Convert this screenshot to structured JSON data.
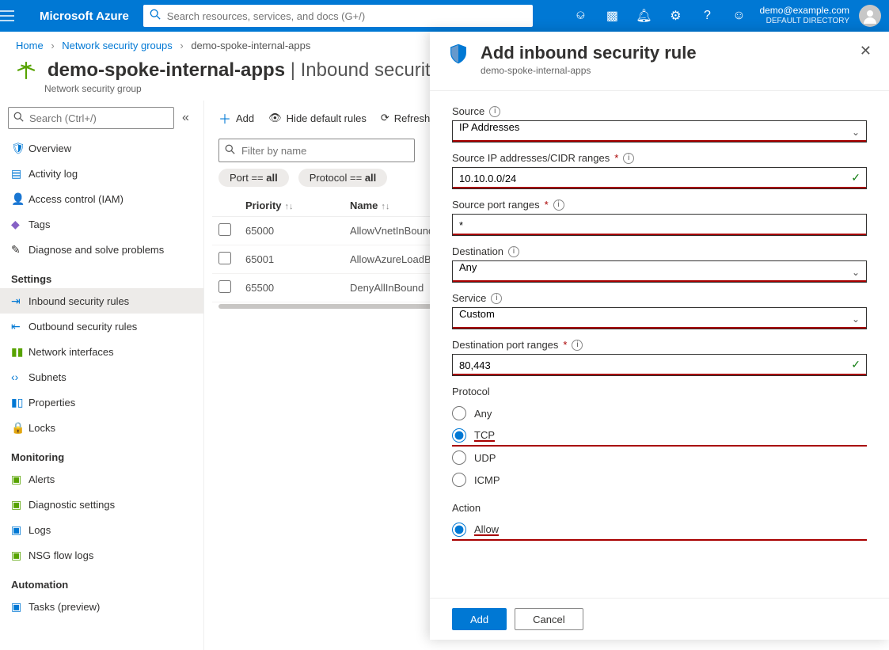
{
  "topbar": {
    "brand": "Microsoft Azure",
    "search_placeholder": "Search resources, services, and docs (G+/)",
    "account_email": "demo@example.com",
    "account_dir": "DEFAULT DIRECTORY"
  },
  "breadcrumbs": [
    {
      "label": "Home"
    },
    {
      "label": "Network security groups"
    },
    {
      "label": "demo-spoke-internal-apps"
    }
  ],
  "page": {
    "title": "demo-spoke-internal-apps",
    "title_suffix": " | Inbound security",
    "subtitle": "Network security group"
  },
  "side_search_placeholder": "Search (Ctrl+/)",
  "sidebar": [
    {
      "icon": "🛡",
      "iconColor": "#0078d4",
      "label": "Overview"
    },
    {
      "icon": "▤",
      "iconColor": "#0078d4",
      "label": "Activity log"
    },
    {
      "icon": "👤",
      "iconColor": "#323130",
      "label": "Access control (IAM)"
    },
    {
      "icon": "◆",
      "iconColor": "#8661c5",
      "label": "Tags"
    },
    {
      "icon": "✎",
      "iconColor": "#323130",
      "label": "Diagnose and solve problems"
    }
  ],
  "sidebar_settings_header": "Settings",
  "sidebar_settings": [
    {
      "icon": "⇥",
      "iconColor": "#0078d4",
      "label": "Inbound security rules",
      "active": true
    },
    {
      "icon": "⇤",
      "iconColor": "#0078d4",
      "label": "Outbound security rules"
    },
    {
      "icon": "▮▮",
      "iconColor": "#57a300",
      "label": "Network interfaces"
    },
    {
      "icon": "‹›",
      "iconColor": "#0078d4",
      "label": "Subnets"
    },
    {
      "icon": "▮▯",
      "iconColor": "#0078d4",
      "label": "Properties"
    },
    {
      "icon": "🔒",
      "iconColor": "#323130",
      "label": "Locks"
    }
  ],
  "sidebar_monitoring_header": "Monitoring",
  "sidebar_monitoring": [
    {
      "icon": "▣",
      "iconColor": "#57a300",
      "label": "Alerts"
    },
    {
      "icon": "▣",
      "iconColor": "#57a300",
      "label": "Diagnostic settings"
    },
    {
      "icon": "▣",
      "iconColor": "#0078d4",
      "label": "Logs"
    },
    {
      "icon": "▣",
      "iconColor": "#57a300",
      "label": "NSG flow logs"
    }
  ],
  "sidebar_automation_header": "Automation",
  "sidebar_automation": [
    {
      "icon": "▣",
      "iconColor": "#0078d4",
      "label": "Tasks (preview)"
    }
  ],
  "toolbar": {
    "add": "Add",
    "hide": "Hide default rules",
    "refresh": "Refresh"
  },
  "filter_placeholder": "Filter by name",
  "pills": {
    "port_label": "Port == ",
    "port_val": "all",
    "proto_label": "Protocol == ",
    "proto_val": "all"
  },
  "table": {
    "h_priority": "Priority",
    "h_name": "Name",
    "rows": [
      {
        "priority": "65000",
        "name": "AllowVnetInBound"
      },
      {
        "priority": "65001",
        "name": "AllowAzureLoadBalancerInBound"
      },
      {
        "priority": "65500",
        "name": "DenyAllInBound"
      }
    ]
  },
  "panel": {
    "title": "Add inbound security rule",
    "context": "demo-spoke-internal-apps",
    "labels": {
      "source": "Source",
      "source_ip": "Source IP addresses/CIDR ranges",
      "source_port": "Source port ranges",
      "destination": "Destination",
      "service": "Service",
      "dest_port": "Destination port ranges",
      "protocol": "Protocol",
      "action": "Action"
    },
    "values": {
      "source": "IP Addresses",
      "source_ip": "10.10.0.0/24",
      "source_port": "*",
      "destination": "Any",
      "service": "Custom",
      "dest_port": "80,443"
    },
    "protocol_options": [
      "Any",
      "TCP",
      "UDP",
      "ICMP"
    ],
    "protocol_selected": "TCP",
    "action_options": [
      "Allow"
    ],
    "action_selected": "Allow",
    "buttons": {
      "add": "Add",
      "cancel": "Cancel"
    }
  }
}
